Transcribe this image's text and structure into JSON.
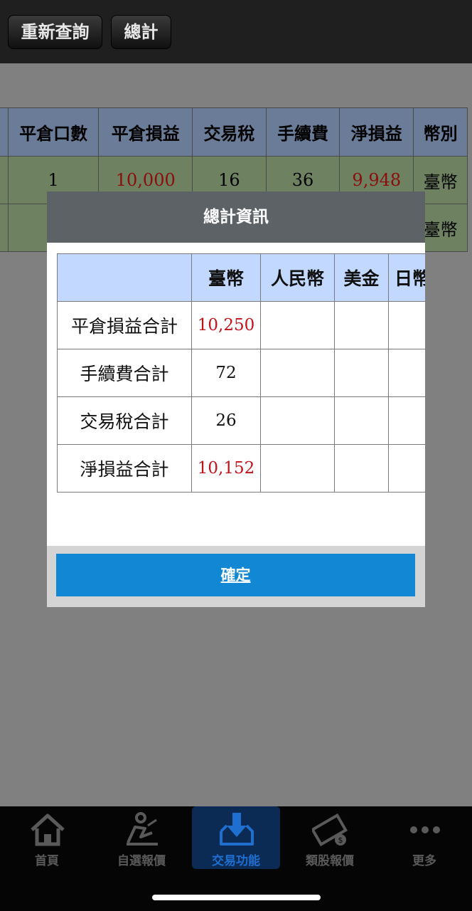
{
  "topbar": {
    "requery_label": "重新查詢",
    "total_label": "總計"
  },
  "bg_table": {
    "headers": [
      "平倉口數",
      "平倉損益",
      "交易稅",
      "手續費",
      "淨損益",
      "幣別"
    ],
    "row1": {
      "qty": "1",
      "pnl": "10,000",
      "tax": "16",
      "fee": "36",
      "net": "9,948",
      "currency": "臺幣"
    },
    "row2": {
      "currency": "臺幣"
    }
  },
  "modal": {
    "title": "總計資訊",
    "columns": [
      "",
      "臺幣",
      "人民幣",
      "美金",
      "日幣"
    ],
    "rows": [
      {
        "label": "平倉損益合計",
        "twd": "10,250"
      },
      {
        "label": "手續費合計",
        "twd": "72"
      },
      {
        "label": "交易稅合計",
        "twd": "26"
      },
      {
        "label": "淨損益合計",
        "twd": "10,152"
      }
    ],
    "confirm_label": "確定"
  },
  "tabbar": {
    "items": [
      {
        "label": "首頁",
        "icon": "home-icon"
      },
      {
        "label": "自選報價",
        "icon": "person-chart-icon"
      },
      {
        "label": "交易功能",
        "icon": "download-tray-icon"
      },
      {
        "label": "類股報價",
        "icon": "film-coin-icon"
      },
      {
        "label": "更多",
        "icon": "more-dots-icon"
      }
    ],
    "active": "交易功能"
  },
  "colors": {
    "header_bg": "#6b7c99",
    "row_bg": "#6e8160",
    "modal_header": "#5c6266",
    "confirm_bg": "#1287d3",
    "loss_profit_red": "#c4131b",
    "active_tab": "#1f6fd0"
  }
}
